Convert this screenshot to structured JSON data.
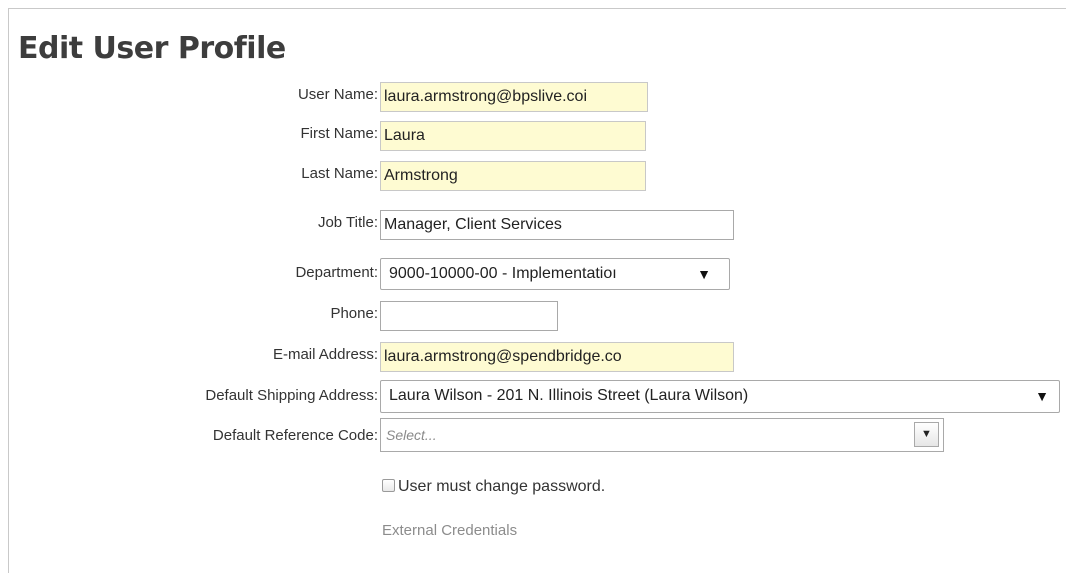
{
  "page": {
    "title": "Edit User Profile"
  },
  "form": {
    "user_name": {
      "label": "User Name:",
      "value": "laura.armstrong@bpslive.coi"
    },
    "first_name": {
      "label": "First Name:",
      "value": "Laura"
    },
    "last_name": {
      "label": "Last Name:",
      "value": "Armstrong"
    },
    "job_title": {
      "label": "Job Title:",
      "value": "Manager, Client Services"
    },
    "department": {
      "label": "Department:",
      "value": "9000-10000-00 - Implementatioı",
      "arrow": "▼"
    },
    "phone": {
      "label": "Phone:",
      "value": ""
    },
    "email": {
      "label": "E-mail Address:",
      "value": "laura.armstrong@spendbridge.co"
    },
    "shipping": {
      "label": "Default Shipping Address:",
      "value": "Laura Wilson - 201 N. Illinois Street (Laura Wilson)",
      "arrow": "▼"
    },
    "reference_code": {
      "label": "Default Reference Code:",
      "placeholder": "Select...",
      "arrow": "▼"
    },
    "must_change_password": {
      "label": "User must change password.",
      "checked": false
    },
    "external_credentials": "External Credentials"
  },
  "colors": {
    "highlight_field": "#fefbd2",
    "title": "#3d3d3d",
    "muted_link": "#8c8c8c"
  }
}
